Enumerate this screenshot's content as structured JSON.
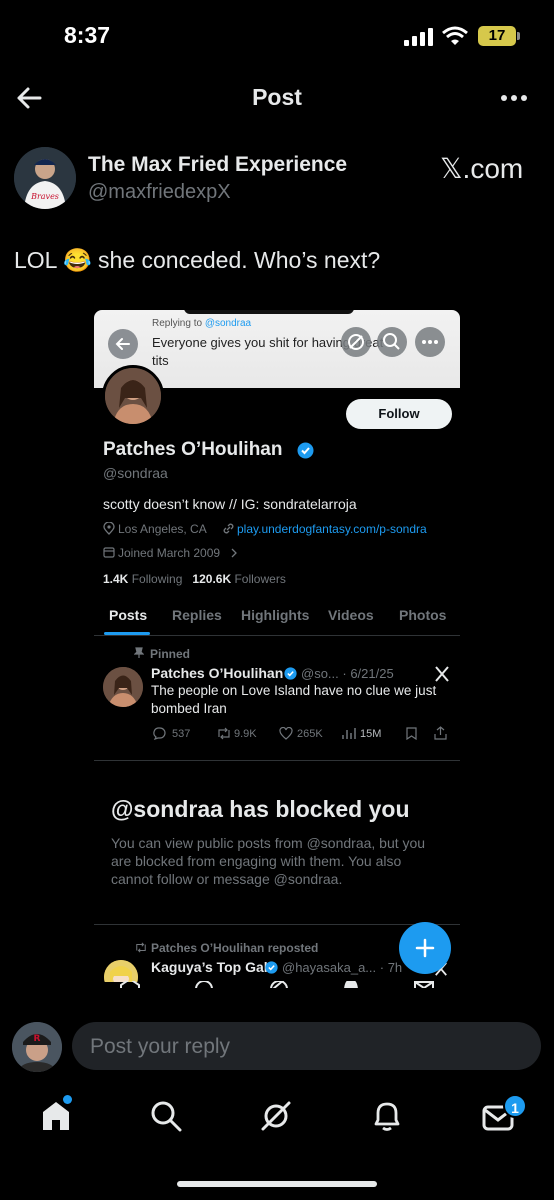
{
  "status_bar": {
    "time": "8:37",
    "battery": "17"
  },
  "header": {
    "title": "Post"
  },
  "post": {
    "author_name": "The Max Fried Experience",
    "author_handle": "@maxfriedexpX",
    "source_label": "𝕏.com",
    "text": "LOL 😂 she conceded. Who’s next?"
  },
  "embed": {
    "reply_prefix": "Replying to",
    "reply_to": "@sondraa",
    "reply_text_1": "Everyone gives you shit for having great",
    "reply_text_2": "tits",
    "follow_label": "Follow",
    "profile_name": "Patches O’Houlihan",
    "profile_handle": "@sondraa",
    "bio": "scotty doesn’t know // IG: sondratelarroja",
    "location": "Los Angeles, CA",
    "link": "play.underdogfantasy.com/p-sondra",
    "joined": "Joined March 2009",
    "following_count": "1.4K",
    "following_label": "Following",
    "followers_count": "120.6K",
    "followers_label": "Followers",
    "tabs": [
      "Posts",
      "Replies",
      "Highlights",
      "Videos",
      "Photos"
    ],
    "pinned_label": "Pinned",
    "pinned_name": "Patches O’Houlihan",
    "pinned_handle_date": "@so... · 6/21/25",
    "pinned_text_1": "The people on Love Island have no clue we just",
    "pinned_text_2": "bombed Iran",
    "stats": {
      "replies": "537",
      "reposts": "9.9K",
      "likes": "265K",
      "views": "15M"
    },
    "blocked_title": "@sondraa has blocked you",
    "blocked_text_1": "You can view public posts from @sondraa, but you",
    "blocked_text_2": "are blocked from engaging with them. You also",
    "blocked_text_3": "cannot follow or message @sondraa.",
    "repost_label": "Patches O’Houlihan reposted",
    "repost_name": "Kaguya’s Top Gal",
    "repost_handle": "@hayasaka_a... · 7h"
  },
  "reply": {
    "placeholder": "Post your reply"
  },
  "nav": {
    "messages_badge": "1"
  },
  "colors": {
    "accent": "#1d9bf0",
    "background": "#000000",
    "reply_box": "#202327"
  }
}
